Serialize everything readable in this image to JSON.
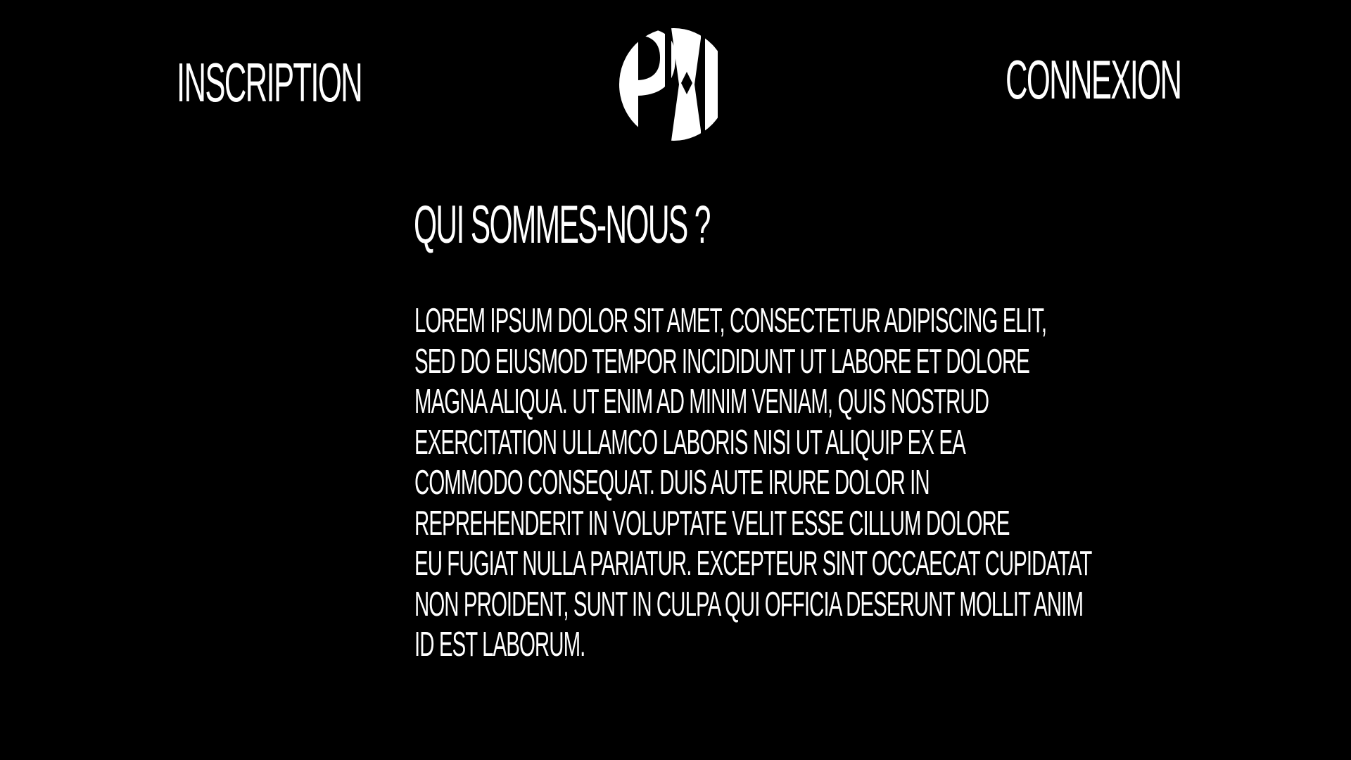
{
  "nav": {
    "inscription_label": "INSCRIPTION",
    "connexion_label": "CONNEXION"
  },
  "logo": {
    "text": "PXL",
    "icon": "pxl-logo-icon"
  },
  "main": {
    "title": "QUI SOMMES-NOUS ?",
    "body_lines": [
      "LOREM IPSUM DOLOR SIT AMET, CONSECTETUR ADIPISCING ELIT,",
      "SED DO EIUSMOD TEMPOR INCIDIDUNT UT LABORE ET DOLORE",
      "MAGNA ALIQUA. UT ENIM AD MINIM VENIAM, QUIS NOSTRUD",
      "EXERCITATION ULLAMCO LABORIS NISI UT ALIQUIP EX EA",
      "COMMODO CONSEQUAT. DUIS AUTE IRURE DOLOR IN",
      "REPREHENDERIT IN VOLUPTATE VELIT ESSE CILLUM DOLORE",
      "EU FUGIAT NULLA PARIATUR. EXCEPTEUR SINT OCCAECAT CUPIDATAT",
      "NON PROIDENT, SUNT IN CULPA QUI OFFICIA DESERUNT MOLLIT ANIM",
      "ID EST LABORUM."
    ]
  },
  "colors": {
    "background": "#000000",
    "text": "#ffffff"
  }
}
